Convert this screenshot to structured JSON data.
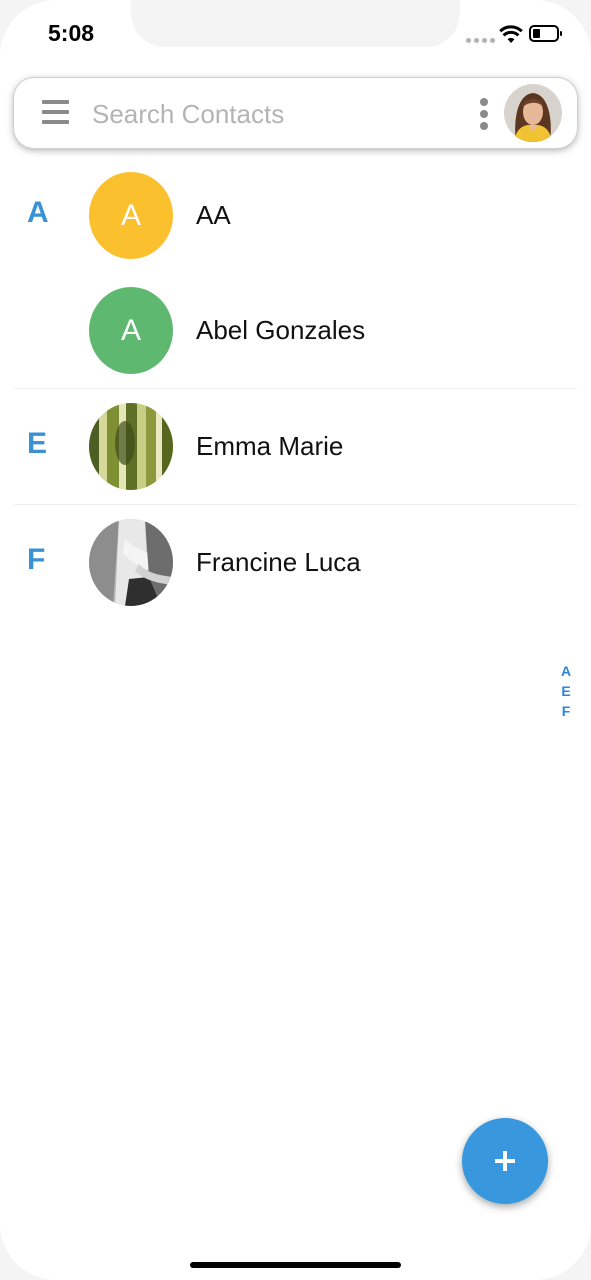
{
  "status_bar": {
    "time": "5:08"
  },
  "search": {
    "placeholder": "Search Contacts",
    "menu_icon": "hamburger-menu-icon",
    "more_icon": "more-vertical-icon"
  },
  "contacts": [
    {
      "section": "A",
      "name": "AA",
      "avatar_letter": "A",
      "avatar_color": "#fbc02d",
      "avatar_type": "letter"
    },
    {
      "section": "",
      "name": "Abel Gonzales",
      "avatar_letter": "A",
      "avatar_color": "#5fb870",
      "avatar_type": "letter"
    },
    {
      "section": "E",
      "name": "Emma Marie",
      "avatar_type": "photo",
      "photo": "bamboo-photo"
    },
    {
      "section": "F",
      "name": "Francine Luca",
      "avatar_type": "photo",
      "photo": "waterfall-photo"
    }
  ],
  "alpha_index": [
    "A",
    "E",
    "F"
  ],
  "fab": {
    "label": "+",
    "icon": "plus-icon",
    "color": "#3897dd"
  },
  "colors": {
    "accent": "#3a92d4"
  }
}
